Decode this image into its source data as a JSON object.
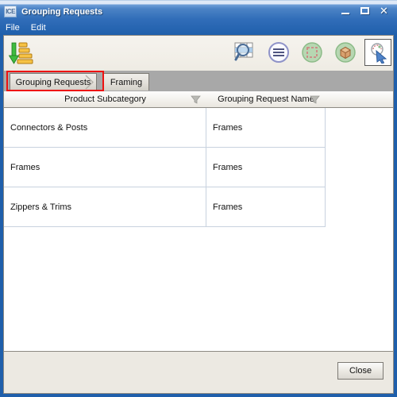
{
  "window": {
    "title": "Grouping Requests",
    "app_icon": "ICE",
    "icon_label": "ice-app-icon",
    "buttons": {
      "minimize": "minimize-button",
      "maximize": "maximize-button",
      "close": "✕"
    }
  },
  "menubar": {
    "items": [
      {
        "label": "File"
      },
      {
        "label": "Edit"
      }
    ]
  },
  "toolbar": {
    "left_items": [
      {
        "name": "sort-descending-icon",
        "tooltip": "Sort Descending"
      }
    ],
    "right_items": [
      {
        "name": "find-in-table-icon"
      },
      {
        "name": "menu-list-icon"
      },
      {
        "name": "select-region-icon"
      },
      {
        "name": "box-object-icon"
      },
      {
        "name": "zoom-select-tool-icon",
        "state": "pressed"
      }
    ]
  },
  "tabs": {
    "items": [
      {
        "label": "Grouping Requests",
        "active": true,
        "highlighted": true
      },
      {
        "label": "Framing",
        "active": false,
        "highlighted": false
      }
    ]
  },
  "grid": {
    "columns": [
      {
        "header": "Product Subcategory",
        "filterable": true
      },
      {
        "header": "Grouping Request Name",
        "filterable": true
      }
    ],
    "rows": [
      {
        "product_subcategory": "Connectors & Posts",
        "grouping_request_name": "Frames"
      },
      {
        "product_subcategory": "Frames",
        "grouping_request_name": "Frames"
      },
      {
        "product_subcategory": "Zippers & Trims",
        "grouping_request_name": "Frames"
      }
    ]
  },
  "footer": {
    "close_label": "Close"
  },
  "colors": {
    "titlebar_blue": "#2f6cb8",
    "window_frame": "#1f5fab",
    "toolbar_bg": "#f2f0ea",
    "tabstrip_bg": "#a8a8a8",
    "panel_bg": "#ece9e2",
    "highlight_red": "#ee1111",
    "grid_line": "#c8d2df"
  }
}
